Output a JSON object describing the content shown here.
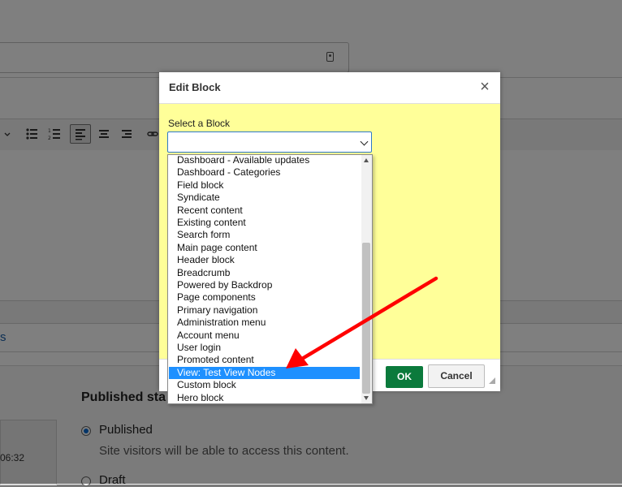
{
  "background": {
    "partial_link": "s",
    "time_fragment": "06:32",
    "publishing": {
      "title": "Published sta",
      "options": [
        {
          "label": "Published",
          "selected": true
        },
        {
          "label": "Draft",
          "selected": false
        }
      ],
      "published_description": "Site visitors will be able to access this content."
    },
    "toolbar_icons": [
      "chevron-down-icon",
      "bulleted-list-icon",
      "numbered-list-icon",
      "align-left-icon",
      "align-center-icon",
      "align-right-icon",
      "link-icon"
    ]
  },
  "dialog": {
    "title": "Edit Block",
    "close_glyph": "×",
    "body_color": "#ffff99",
    "select_label": "Select a Block",
    "select_value": "",
    "ok_label": "OK",
    "cancel_label": "Cancel",
    "ok_color": "#0b7a3c"
  },
  "dropdown": {
    "options": [
      "Dashboard - Available updates",
      "Dashboard - Categories",
      "Field block",
      "Syndicate",
      "Recent content",
      "Existing content",
      "Search form",
      "Main page content",
      "Header block",
      "Breadcrumb",
      "Powered by Backdrop",
      "Page components",
      "Primary navigation",
      "Administration menu",
      "Account menu",
      "User login",
      "Promoted content",
      "View: Test View Nodes",
      "Custom block",
      "Hero block"
    ],
    "highlighted": "View: Test View Nodes",
    "highlight_color": "#1e90ff"
  },
  "annotation": {
    "arrow_color": "#ff0000"
  }
}
